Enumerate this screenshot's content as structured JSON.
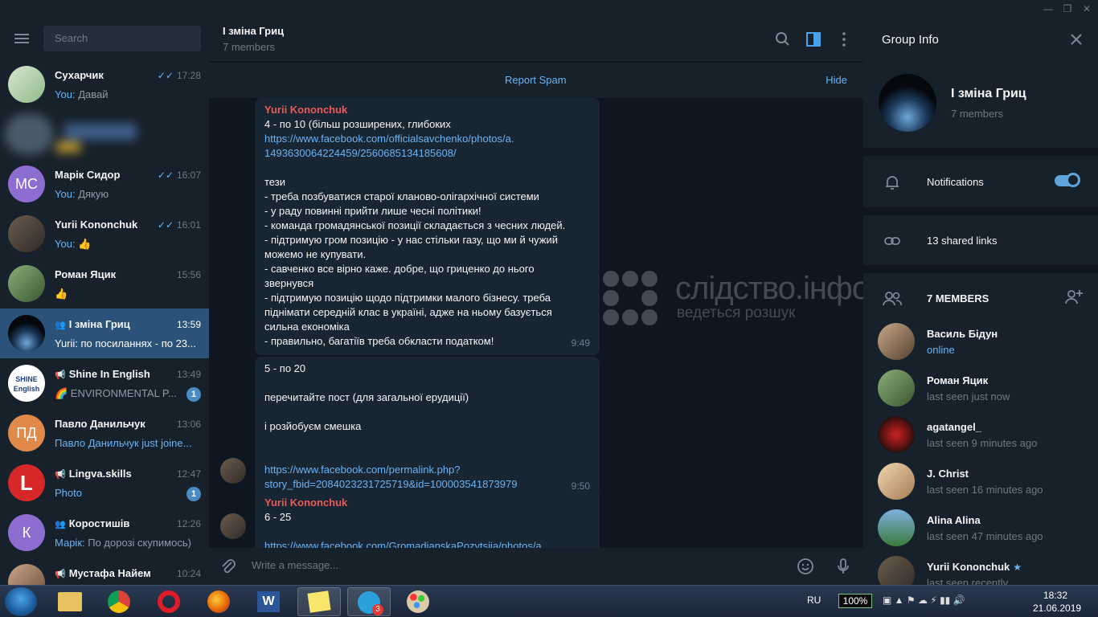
{
  "sidebar": {
    "search_placeholder": "Search",
    "chats": [
      {
        "name": "Сухарчик",
        "time": "17:28",
        "prefix": "You:",
        "preview": "Давай",
        "read": true
      },
      {
        "name": "",
        "time": "",
        "prefix": "",
        "preview": "",
        "blurred": true
      },
      {
        "name": "Марік Сидор",
        "time": "16:07",
        "prefix": "You:",
        "preview": "Дякую",
        "initials": "МС",
        "read": true
      },
      {
        "name": "Yurii Kononchuk",
        "time": "16:01",
        "prefix": "You:",
        "preview": "👍",
        "read": true
      },
      {
        "name": "Роман Яцик",
        "time": "15:56",
        "prefix": "",
        "preview": "👍"
      },
      {
        "name": "І зміна Гриц",
        "time": "13:59",
        "prefix": "",
        "preview": "Yurii: по посиланнях - по 23...",
        "active": true,
        "type_icon": "group-icon"
      },
      {
        "name": "Shine In English",
        "time": "13:49",
        "prefix": "",
        "preview": "🌈 ENVIRONMENTAL P...",
        "badge": "1",
        "type_icon": "channel-icon"
      },
      {
        "name": "Павло Данильчук",
        "time": "13:06",
        "prefix": "",
        "preview": "Павло Данильчук just joine...",
        "initials": "ПД"
      },
      {
        "name": "Lingva.skills",
        "time": "12:47",
        "prefix": "",
        "preview": "Photo",
        "badge": "1",
        "type_icon": "channel-icon"
      },
      {
        "name": "Коростишів",
        "time": "12:26",
        "prefix": "",
        "preview": "Марік: По дорозі скупимось)",
        "initials": "К",
        "type_icon": "group-icon"
      },
      {
        "name": "Мустафа Найем",
        "time": "10:24",
        "prefix": "",
        "preview": "",
        "type_icon": "channel-icon"
      }
    ]
  },
  "chat": {
    "title": "І зміна Гриц",
    "subtitle": "7 members",
    "report_spam": "Report Spam",
    "hide": "Hide",
    "composer_placeholder": "Write a message...",
    "messages": [
      {
        "author": "Yurii Kononchuk",
        "lines": [
          {
            "t": "4 - по 10 (більш розширених, глибоких"
          },
          {
            "t": "https://www.facebook.com/officialsavchenko/photos/a.",
            "link": true
          },
          {
            "t": "1493630064224459/2560685134185608/",
            "link": true
          },
          {
            "t": ""
          },
          {
            "t": "тези"
          },
          {
            "t": "- треба позбуватися старої кланово-олігархічної системи"
          },
          {
            "t": "- у раду повинні прийти лише чесні політики!"
          },
          {
            "t": "- команда громадянської позиції складається з чесних людей."
          },
          {
            "t": "- підтримую гром позицію - у нас стільки газу, що ми й чужий"
          },
          {
            "t": "можемо не купувати."
          },
          {
            "t": "- савченко все вірно каже. добре, що гриценко до нього"
          },
          {
            "t": "звернувся"
          },
          {
            "t": "- підтримую позицію щодо підтримки малого бізнесу. треба"
          },
          {
            "t": "піднімати середній клас в україні, адже на ньому базується"
          },
          {
            "t": "сильна економіка"
          },
          {
            "t": "- правильно, багатіїв треба обкласти податком!"
          }
        ],
        "time": "9:49"
      },
      {
        "author": "",
        "lines": [
          {
            "t": "5 - по 20"
          },
          {
            "t": ""
          },
          {
            "t": "перечитайте пост (для загальної ерудиції)"
          },
          {
            "t": ""
          },
          {
            "t": "і розйобуєм смешка"
          },
          {
            "t": ""
          },
          {
            "t": ""
          },
          {
            "t": "https://www.facebook.com/permalink.php?",
            "link": true
          },
          {
            "t": "story_fbid=2084023231725719&id=100003541873979",
            "link": true
          }
        ],
        "time": "9:50"
      },
      {
        "author": "Yurii Kononchuk",
        "lines": [
          {
            "t": "6 - 25"
          },
          {
            "t": ""
          },
          {
            "t": "https://www.facebook.com/GromadianskaPozytsiia/photos/a.",
            "link": true
          }
        ],
        "time": ""
      }
    ],
    "watermark": {
      "title": "слідство.інфо",
      "subtitle": "ведеться розшук"
    }
  },
  "info": {
    "header": "Group Info",
    "group_name": "І зміна Гриц",
    "group_sub": "7 members",
    "notifications_label": "Notifications",
    "notifications_on": true,
    "links_label": "13 shared links",
    "members_label": "7 MEMBERS",
    "members": [
      {
        "name": "Василь Бідун",
        "status": "online",
        "online": true
      },
      {
        "name": "Роман Яцик",
        "status": "last seen just now"
      },
      {
        "name": "agatangel_",
        "status": "last seen 9 minutes ago"
      },
      {
        "name": "J. Christ",
        "status": "last seen 16 minutes ago"
      },
      {
        "name": "Alina Alina",
        "status": "last seen 47 minutes ago"
      },
      {
        "name": "Yurii Kononchuk",
        "status": "last seen recently",
        "admin": true
      }
    ]
  },
  "taskbar": {
    "language": "RU",
    "battery": "100%",
    "time": "18:32",
    "date": "21.06.2019",
    "telegram_badge": "3"
  },
  "colors": {
    "accent": "#6ab3f3",
    "active_chat": "#2b5278",
    "bg_dark": "#0e1621",
    "panel": "#17212b",
    "bubble": "#182533",
    "author_red": "#e85a5a"
  }
}
